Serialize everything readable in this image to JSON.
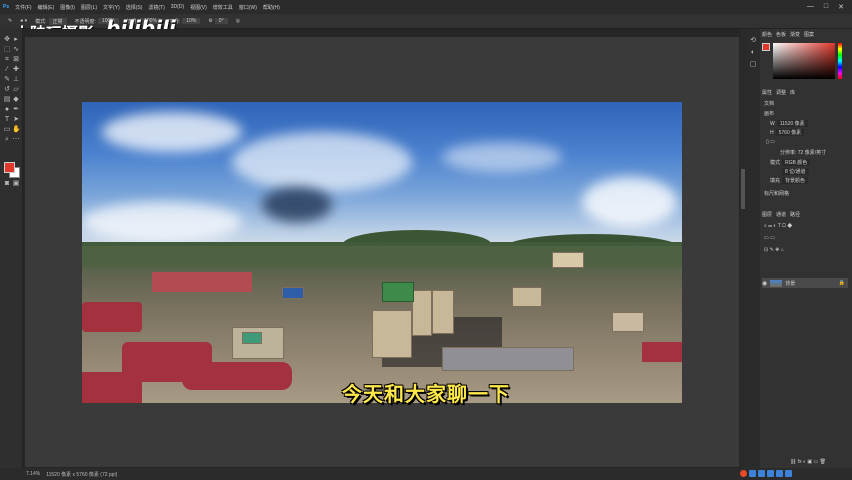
{
  "menubar": {
    "items": [
      "文件(F)",
      "编辑(E)",
      "图像(I)",
      "图层(L)",
      "文字(Y)",
      "选择(S)",
      "滤镜(T)",
      "3D(D)",
      "视图(V)",
      "增效工具",
      "窗口(W)",
      "帮助(H)"
    ],
    "window_controls": [
      "—",
      "□",
      "✕"
    ]
  },
  "optbar": {
    "mode_label": "模式:",
    "mode_value": "正常",
    "opacity_label": "不透明度:",
    "opacity_value": "100%",
    "flow_label": "流量:",
    "flow_value": "100%",
    "smooth_label": "平滑:",
    "smooth_value": "10%",
    "angle_value": "0°"
  },
  "watermark": {
    "channel": "小陆玩摄影",
    "bili_logo": "bilibili"
  },
  "subtitle": "今天和大家聊一下",
  "panel": {
    "color_tabs": [
      "颜色",
      "色板",
      "渐变",
      "图案"
    ],
    "properties_tabs": [
      "属性",
      "调整",
      "库"
    ],
    "doc_label": "文档",
    "canvas_label": "画布",
    "width_label": "W",
    "width_value": "11520 像素",
    "height_label": "H",
    "height_value": "5760 像素",
    "resolution_label": "分辨率: 72 像素/英寸",
    "mode_label": "模式",
    "mode_value": "RGB 颜色",
    "depth_value": "8 位/通道",
    "fill_label": "填充",
    "fill_value": "背景颜色",
    "rulers_label": "标尺和网格",
    "layers_tabs": [
      "图层",
      "通道",
      "路径"
    ],
    "layer_name": "背景"
  },
  "statusbar": {
    "zoom": "7.14%",
    "doc_info": "11520 像素 x 5760 像素 (72 ppi)"
  },
  "colors": {
    "foreground": "#e0382c",
    "background": "#ffffff",
    "subtitle": "#ffe94a"
  }
}
